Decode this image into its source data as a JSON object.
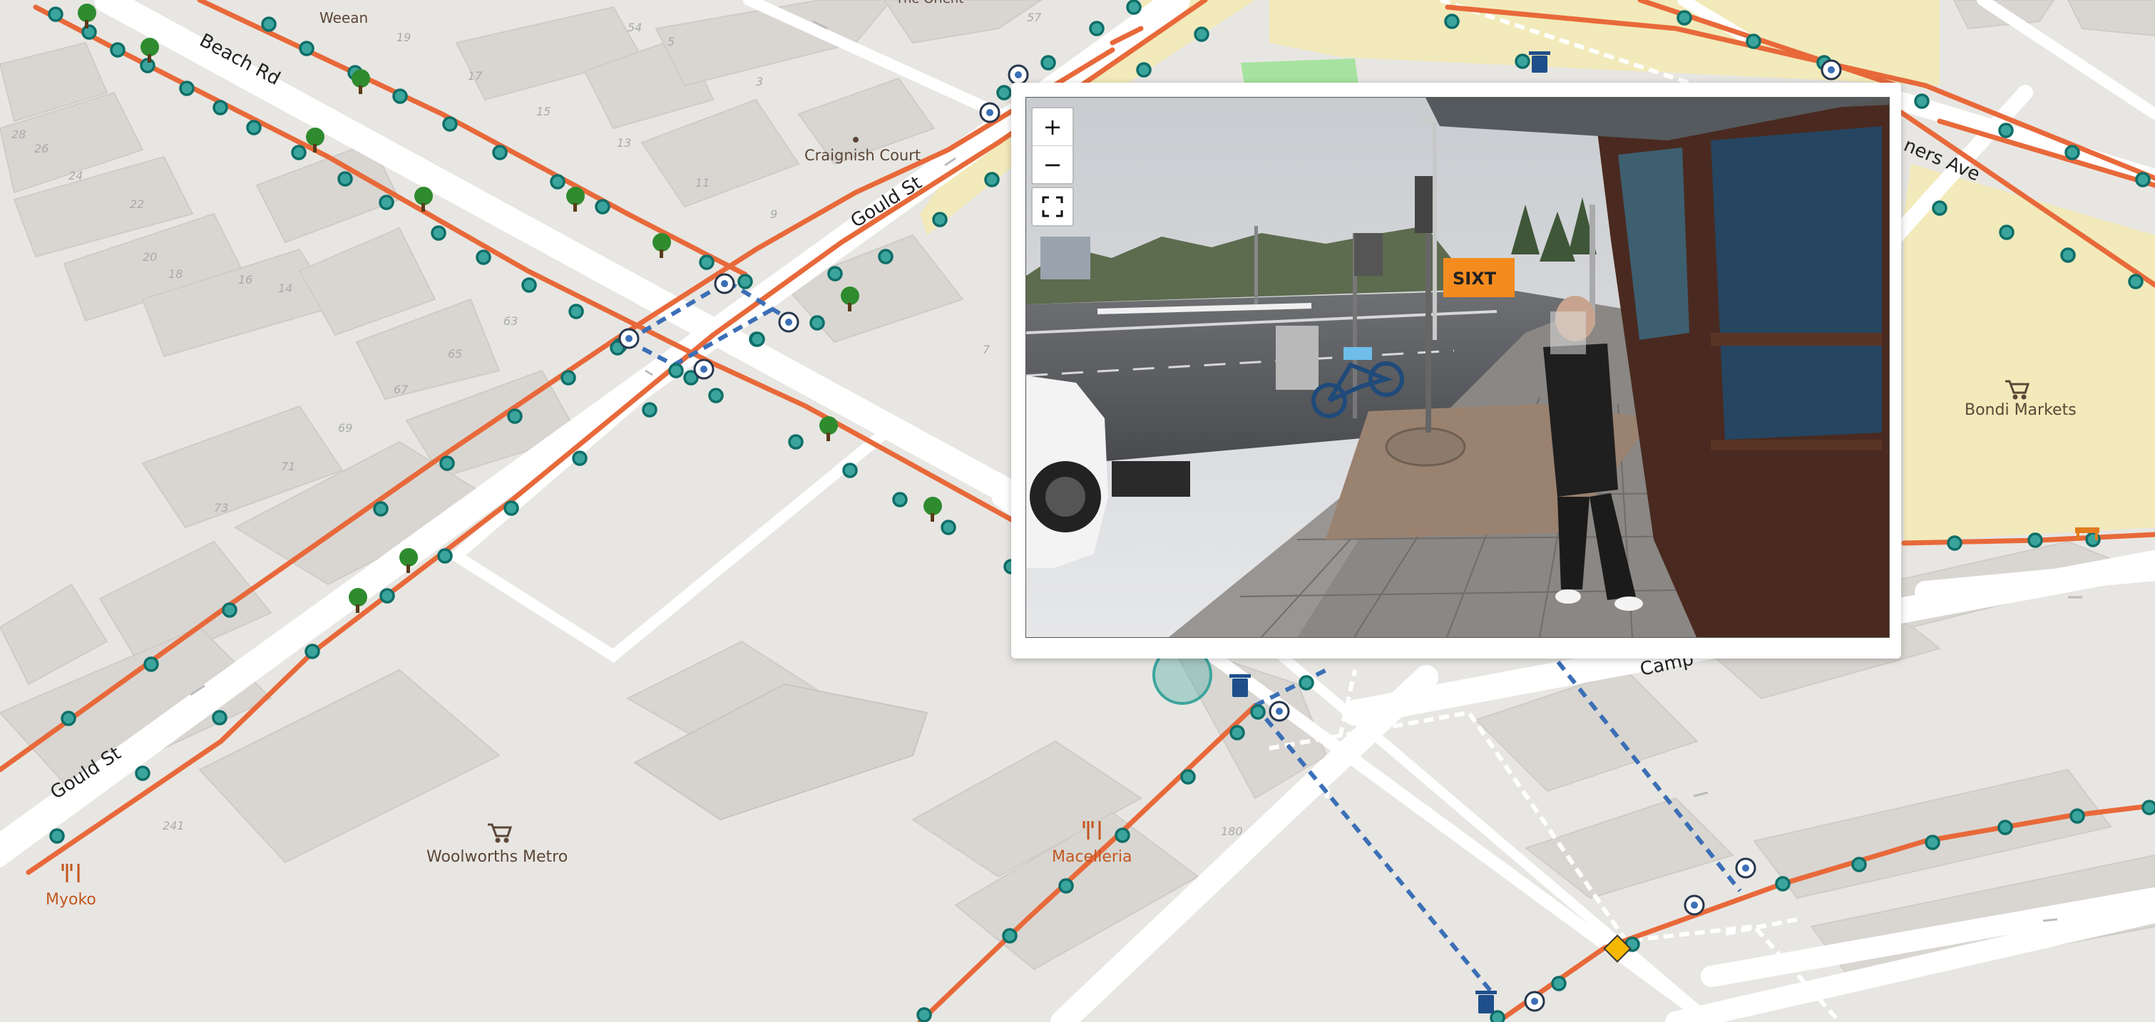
{
  "streets": {
    "beach_rd": "Beach Rd",
    "gould_st_upper": "Gould St",
    "gould_st_lower": "Gould St",
    "campbell": "Camp",
    "chambers": "ners Ave"
  },
  "places": {
    "weean": "Weean",
    "the_orient": "The Orient",
    "craignish_court": "Craignish Court",
    "bondi_markets": "Bondi Markets",
    "woolworths": "Woolworths Metro",
    "macelleria": "Macelleria",
    "myoko": "Myoko"
  },
  "building_numbers": [
    "19",
    "17",
    "15",
    "13",
    "11",
    "9",
    "7",
    "5",
    "3",
    "54",
    "57",
    "63",
    "65",
    "67",
    "69",
    "71",
    "73",
    "28",
    "26",
    "24",
    "22",
    "20",
    "18",
    "16",
    "14",
    "241",
    "180"
  ],
  "viewer": {
    "zoom_in": "+",
    "zoom_out": "−",
    "fullscreen_icon": "fullscreen-icon",
    "van_sign": "SIXT"
  },
  "colors": {
    "sidewalk_line": "#e8693a",
    "node": "#3ba59d",
    "crossing": "#3b6fb6",
    "park": "#f2eaba",
    "grass": "#a6e3a0",
    "tree": "#2e8b2e"
  },
  "icons": [
    "tree-icon",
    "wheelchair-icon",
    "trash-can-icon",
    "shopping-cart-icon",
    "restaurant-icon",
    "pedestrian-crossing-icon",
    "bench-icon"
  ]
}
